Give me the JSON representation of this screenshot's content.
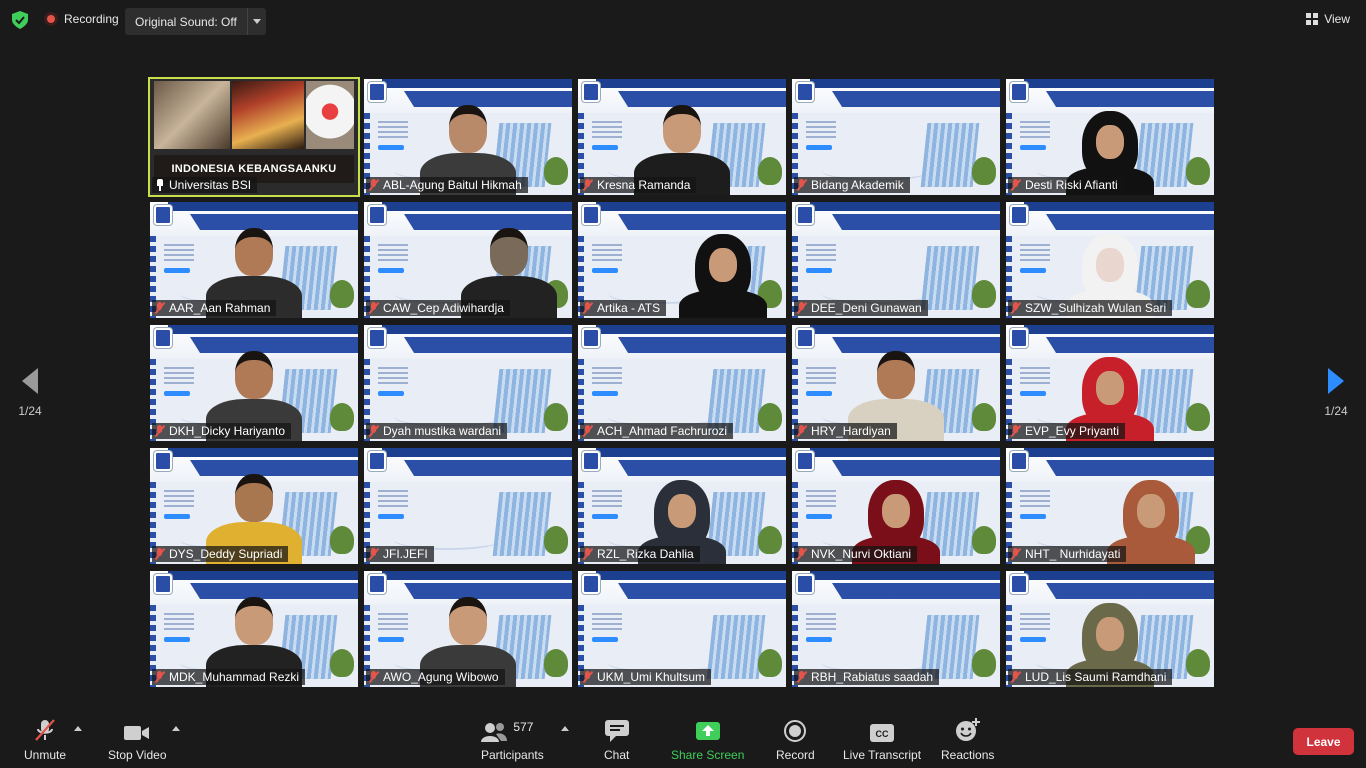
{
  "topbar": {
    "recording_label": "Recording",
    "sound_label": "Original Sound: Off",
    "view_label": "View"
  },
  "pager": {
    "left_page": "1/24",
    "right_page": "1/24"
  },
  "slide_banner": "INDONESIA KEBANGSAANKU",
  "participants": [
    {
      "name": "Universitas BSI",
      "muted": false,
      "pinned": true,
      "kind": "slide",
      "active": true
    },
    {
      "name": "ABL-Agung Baitul Hikmah",
      "muted": true,
      "kind": "man",
      "skin": "#b98a6a",
      "shirt": "#3b3b3b",
      "pos": "c"
    },
    {
      "name": "Kresna Ramanda",
      "muted": false,
      "kind": "man",
      "skin": "#c99a78",
      "shirt": "#1d1d1d",
      "pos": "c"
    },
    {
      "name": "Bidang Akademik",
      "muted": true,
      "kind": "none"
    },
    {
      "name": "Desti Riski Afianti",
      "muted": true,
      "kind": "hijab",
      "skin": "#c99a78",
      "shirt": "#111111",
      "pos": "c"
    },
    {
      "name": "AAR_Aan Rahman",
      "muted": true,
      "kind": "man",
      "skin": "#b07a56",
      "shirt": "#2c2c2c",
      "pos": "c"
    },
    {
      "name": "CAW_Cep Adiwihardja",
      "muted": true,
      "kind": "man",
      "skin": "#7a6a5a",
      "shirt": "#222222",
      "pos": "r"
    },
    {
      "name": "Artika - ATS",
      "muted": true,
      "kind": "hijab",
      "skin": "#c99a78",
      "shirt": "#111111",
      "pos": "r"
    },
    {
      "name": "DEE_Deni Gunawan",
      "muted": true,
      "kind": "none"
    },
    {
      "name": "SZW_Sulhizah Wulan Sari",
      "muted": true,
      "kind": "hijab",
      "skin": "#e8d6cf",
      "shirt": "#f2f2f2",
      "pos": "c"
    },
    {
      "name": "DKH_Dicky Hariyanto",
      "muted": true,
      "kind": "man",
      "skin": "#b07a56",
      "shirt": "#3a3a3a",
      "pos": "c"
    },
    {
      "name": "Dyah mustika wardani",
      "muted": true,
      "kind": "none"
    },
    {
      "name": "ACH_Ahmad Fachrurozi",
      "muted": true,
      "kind": "none"
    },
    {
      "name": "HRY_Hardiyan",
      "muted": true,
      "kind": "man",
      "skin": "#b07a56",
      "shirt": "#d8d0c0",
      "pos": "c"
    },
    {
      "name": "EVP_Evy Priyanti",
      "muted": true,
      "kind": "hijab",
      "skin": "#c99a78",
      "shirt": "#c8202a",
      "pos": "c"
    },
    {
      "name": "DYS_Deddy Supriadi",
      "muted": true,
      "kind": "man",
      "skin": "#a8764f",
      "shirt": "#e0b030",
      "pos": "c"
    },
    {
      "name": "JFI.JEFI",
      "muted": true,
      "kind": "none"
    },
    {
      "name": "RZL_Rizka Dahlia",
      "muted": true,
      "kind": "hijab",
      "skin": "#c99a78",
      "shirt": "#2b2f3a",
      "pos": "c"
    },
    {
      "name": "NVK_Nurvi Oktiani",
      "muted": true,
      "kind": "hijab",
      "skin": "#c99a78",
      "shirt": "#7a0f1a",
      "pos": "c"
    },
    {
      "name": "NHT_ Nurhidayati",
      "muted": true,
      "kind": "hijab",
      "skin": "#c99a78",
      "shirt": "#a85a3a",
      "pos": "r"
    },
    {
      "name": "MDK_Muhammad Rezki",
      "muted": true,
      "kind": "man",
      "skin": "#c99a78",
      "shirt": "#222222",
      "pos": "c"
    },
    {
      "name": "AWO_Agung Wibowo",
      "muted": true,
      "kind": "man",
      "skin": "#c99a78",
      "shirt": "#3a3a3a",
      "pos": "c"
    },
    {
      "name": "UKM_Umi Khultsum",
      "muted": true,
      "kind": "none"
    },
    {
      "name": "RBH_Rabiatus saadah",
      "muted": true,
      "kind": "none"
    },
    {
      "name": "LUD_Lis Saumi Ramdhani",
      "muted": true,
      "kind": "hijab",
      "skin": "#c99a78",
      "shirt": "#6a6a4a",
      "pos": "c"
    }
  ],
  "toolbar": {
    "unmute": "Unmute",
    "stop_video": "Stop Video",
    "participants": "Participants",
    "participants_count": "577",
    "chat": "Chat",
    "share_screen": "Share Screen",
    "record": "Record",
    "live_transcript": "Live Transcript",
    "reactions": "Reactions",
    "leave": "Leave",
    "cc_text": "CC"
  },
  "colors": {
    "accent": "#2d8cff",
    "mute": "#e5544b",
    "active_border": "#c7e04a",
    "leave": "#d0333b",
    "share": "#3fce5a"
  }
}
